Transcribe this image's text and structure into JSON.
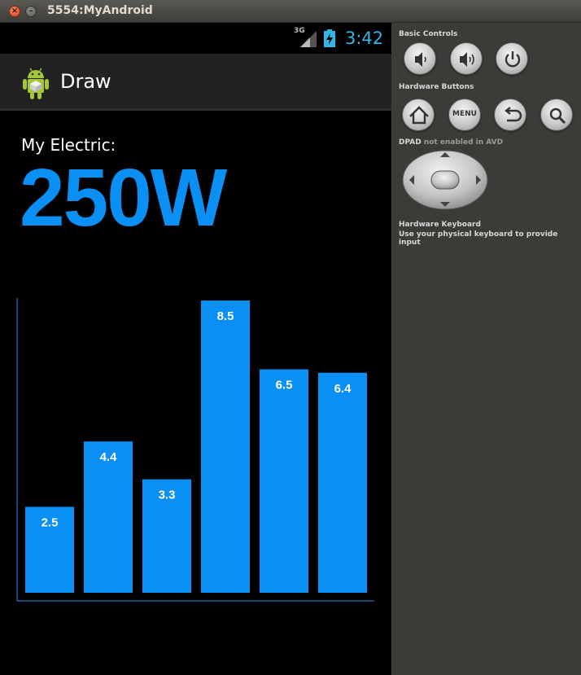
{
  "window": {
    "title": "5554:MyAndroid",
    "close_glyph": "×",
    "min_glyph": "–"
  },
  "status_bar": {
    "network": "3G",
    "time": "3:42",
    "icons": [
      "signal-icon",
      "battery-charging-icon"
    ]
  },
  "action_bar": {
    "title": "Draw",
    "icon": "android-app-icon"
  },
  "content": {
    "label": "My Electric:",
    "value": "250W"
  },
  "chart_data": {
    "type": "bar",
    "values": [
      2.5,
      4.4,
      3.3,
      8.5,
      6.5,
      6.4
    ],
    "value_labels": [
      "2.5",
      "4.4",
      "3.3",
      "8.5",
      "6.5",
      "6.4"
    ],
    "ylim": [
      0,
      9
    ],
    "bar_color": "#0a8ff5",
    "axis_color": "#1b5f9e"
  },
  "controls": {
    "basic_label": "Basic Controls",
    "hardware_label": "Hardware Buttons",
    "dpad_label": "DPAD",
    "dpad_note": "not enabled in AVD",
    "keyboard_label": "Hardware Keyboard",
    "keyboard_note": "Use your physical keyboard to provide input",
    "menu_label": "MENU"
  },
  "colors": {
    "accent": "#0a8ff5",
    "clock": "#33b5e5",
    "panel": "#3c3b37"
  }
}
